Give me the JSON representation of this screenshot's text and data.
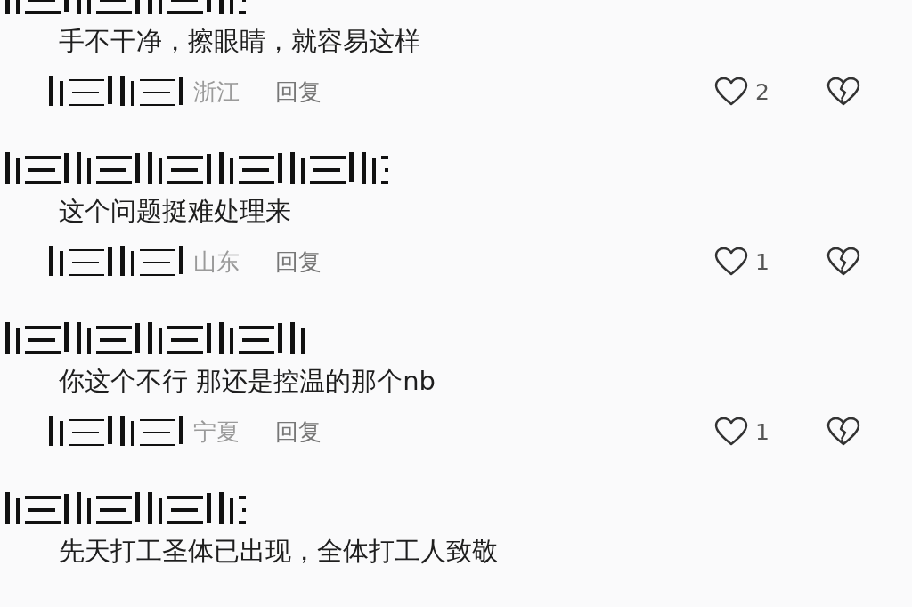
{
  "comments": [
    {
      "text": "手不干净，擦眼睛，就容易这样",
      "region": "浙江",
      "reply": "回复",
      "likes": "2"
    },
    {
      "text": "这个问题挺难处理来",
      "region": "山东",
      "reply": "回复",
      "likes": "1"
    },
    {
      "text": "你这个不行  那还是控温的那个nb",
      "region": "宁夏",
      "reply": "回复",
      "likes": "1"
    },
    {
      "text": "先天打工圣体已出现，全体打工人致敬"
    }
  ]
}
